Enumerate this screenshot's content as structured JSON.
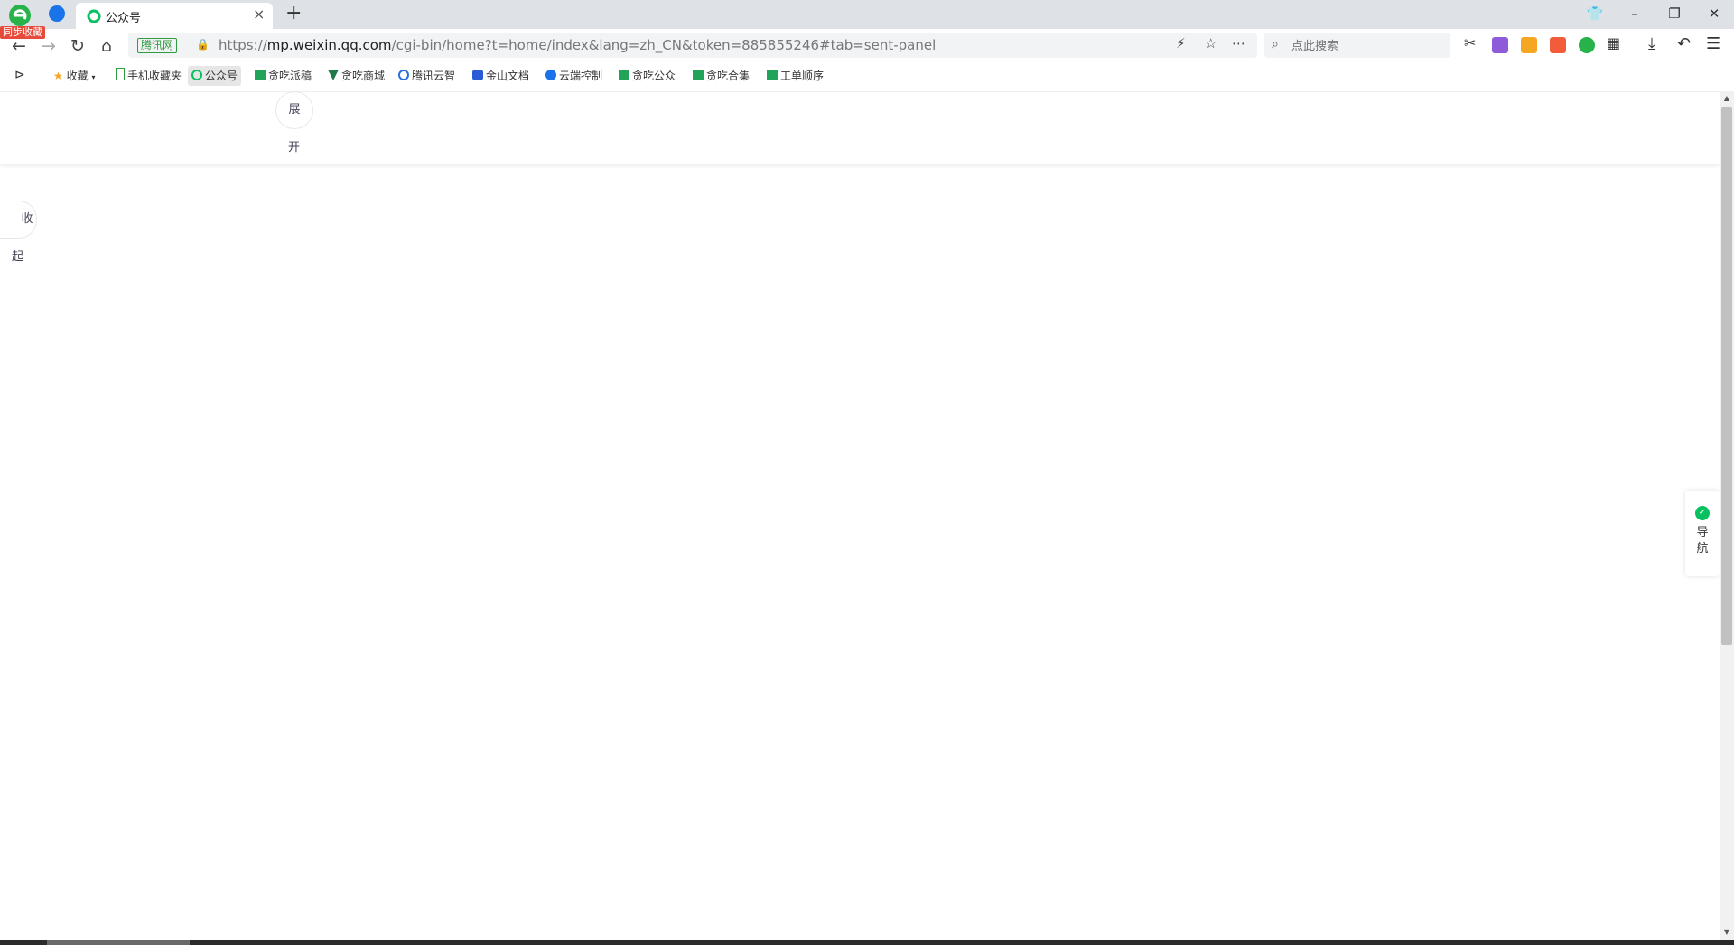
{
  "browser": {
    "sync_badge": "同步收藏",
    "tab": {
      "title": "公众号",
      "close": "×"
    },
    "new_tab": "+",
    "window": {
      "minimize": "–",
      "restore": "❐",
      "close": "✕",
      "skin": "👕"
    }
  },
  "address": {
    "cert_label": "腾讯网",
    "url_prefix": "https://",
    "url_host": "mp.weixin.qq.com",
    "url_rest": "/cgi-bin/home?t=home/index&lang=zh_CN&token=885855246#tab=sent-panel"
  },
  "search": {
    "placeholder": "点此搜索"
  },
  "bookmarks": [
    {
      "label": "收藏",
      "color": "#f5a623"
    },
    {
      "label": "手机收藏夹",
      "color": "#2e9b3e"
    },
    {
      "label": "公众号",
      "color": "#07c160"
    },
    {
      "label": "贪吃派稿",
      "color": "#21a35a"
    },
    {
      "label": "贪吃商城",
      "color": "#1e7a4a"
    },
    {
      "label": "腾讯云智",
      "color": "#2a6fdb"
    },
    {
      "label": "金山文档",
      "color": "#2a5bd7"
    },
    {
      "label": "云端控制",
      "color": "#1a73e8"
    },
    {
      "label": "贪吃公众",
      "color": "#21a35a"
    },
    {
      "label": "贪吃合集",
      "color": "#21a35a"
    },
    {
      "label": "工单顺序",
      "color": "#21a35a"
    }
  ],
  "page": {
    "expand": {
      "top": "展",
      "bottom": "开"
    },
    "collapse": {
      "top": "收",
      "bottom": "起"
    },
    "sidenav_label": "导航"
  },
  "colors": {
    "accent": "#07c160",
    "tabstrip": "#dee1e6"
  }
}
